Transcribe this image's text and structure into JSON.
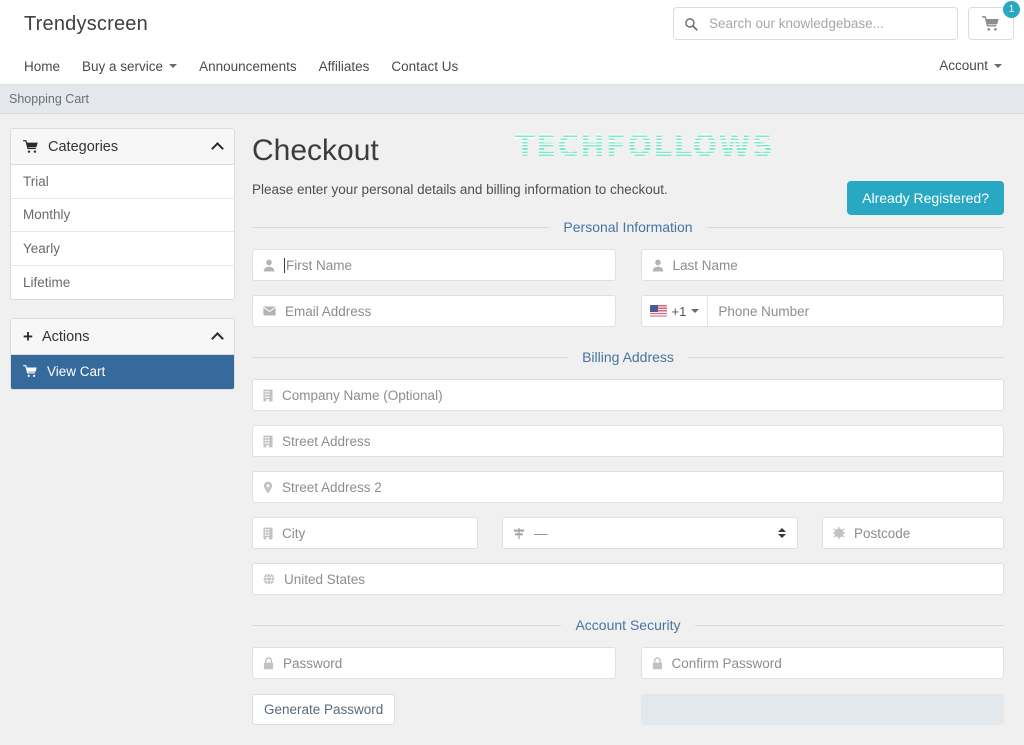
{
  "header": {
    "brand": "Trendyscreen",
    "search": {
      "placeholder": "Search our knowledgebase...",
      "value": "",
      "icon": "search-icon"
    },
    "cart": {
      "icon": "shopping-cart-icon",
      "badge_count": "1"
    }
  },
  "nav": {
    "items": [
      {
        "label": "Home",
        "has_caret": false
      },
      {
        "label": "Buy a service",
        "has_caret": true
      },
      {
        "label": "Announcements",
        "has_caret": false
      },
      {
        "label": "Affiliates",
        "has_caret": false
      },
      {
        "label": "Contact Us",
        "has_caret": false
      }
    ],
    "account": {
      "label": "Account",
      "has_caret": true
    }
  },
  "breadcrumb": {
    "text": "Shopping Cart"
  },
  "sidebar": {
    "categories": {
      "title": "Categories",
      "icon": "shopping-cart-icon",
      "collapse_icon": "chevron-up-icon",
      "items": [
        {
          "label": "Trial"
        },
        {
          "label": "Monthly"
        },
        {
          "label": "Yearly"
        },
        {
          "label": "Lifetime"
        }
      ]
    },
    "actions": {
      "title": "Actions",
      "icon": "plus-icon",
      "collapse_icon": "chevron-up-icon",
      "items": [
        {
          "label": "View Cart",
          "icon": "shopping-cart-icon",
          "active": true
        }
      ]
    }
  },
  "main": {
    "title": "Checkout",
    "watermark": "TECHFOLLOWS",
    "subtitle": "Please enter your personal details and billing information to checkout.",
    "already_registered_label": "Already Registered?",
    "sections": {
      "personal": {
        "legend": "Personal Information",
        "first_name": {
          "placeholder": "First Name",
          "value": "",
          "icon": "user-icon",
          "focused": true
        },
        "last_name": {
          "placeholder": "Last Name",
          "value": "",
          "icon": "user-icon"
        },
        "email": {
          "placeholder": "Email Address",
          "value": "",
          "icon": "envelope-icon"
        },
        "phone": {
          "placeholder": "Phone Number",
          "value": "",
          "country_icon": "us-flag-icon",
          "dial_code": "+1"
        }
      },
      "billing": {
        "legend": "Billing Address",
        "company": {
          "placeholder": "Company Name (Optional)",
          "value": "",
          "icon": "building-icon"
        },
        "street1": {
          "placeholder": "Street Address",
          "value": "",
          "icon": "building-icon"
        },
        "street2": {
          "placeholder": "Street Address 2",
          "value": "",
          "icon": "map-pin-icon"
        },
        "city": {
          "placeholder": "City",
          "value": "",
          "icon": "building-icon"
        },
        "state": {
          "value": "—",
          "icon": "signpost-icon"
        },
        "postcode": {
          "placeholder": "Postcode",
          "value": "",
          "icon": "gear-icon"
        },
        "country": {
          "value": "United States",
          "icon": "globe-icon"
        }
      },
      "security": {
        "legend": "Account Security",
        "password": {
          "placeholder": "Password",
          "value": "",
          "icon": "lock-icon"
        },
        "confirm_password": {
          "placeholder": "Confirm Password",
          "value": "",
          "icon": "lock-icon"
        },
        "generate_label": "Generate Password"
      }
    }
  },
  "colors": {
    "accent_teal": "#29a8c4",
    "active_blue": "#36699c",
    "legend_blue": "#47749f",
    "watermark_mint": "#7aecc4"
  }
}
